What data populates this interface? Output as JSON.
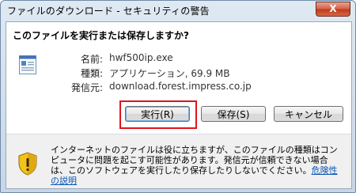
{
  "window": {
    "title": "ファイルのダウンロード - セキュリティの警告",
    "close_label": "X"
  },
  "question": "このファイルを実行または保存しますか?",
  "file_info": {
    "name_label": "名前:",
    "name_value": "hwf500ip.exe",
    "type_label": "種類:",
    "type_value": "アプリケーション, 69.9 MB",
    "publisher_label": "発信元:",
    "publisher_value": "download.forest.impress.co.jp"
  },
  "buttons": {
    "run": "実行(R)",
    "save": "保存(S)",
    "cancel": "キャンセル"
  },
  "warning": {
    "text": "インターネットのファイルは役に立ちますが、このファイルの種類はコンピュータに問題を起こす可能性があります。発信元が信頼できない場合は、このソフトウェアを実行したり保存したりしないでください。",
    "link": "危険性の説明"
  },
  "icons": {
    "file": "executable-file-icon",
    "shield": "security-shield-icon",
    "close": "close-icon"
  },
  "colors": {
    "focus_ring": "#e0141e",
    "link": "#0b55b5",
    "shield_yellow": "#f3c21b"
  }
}
